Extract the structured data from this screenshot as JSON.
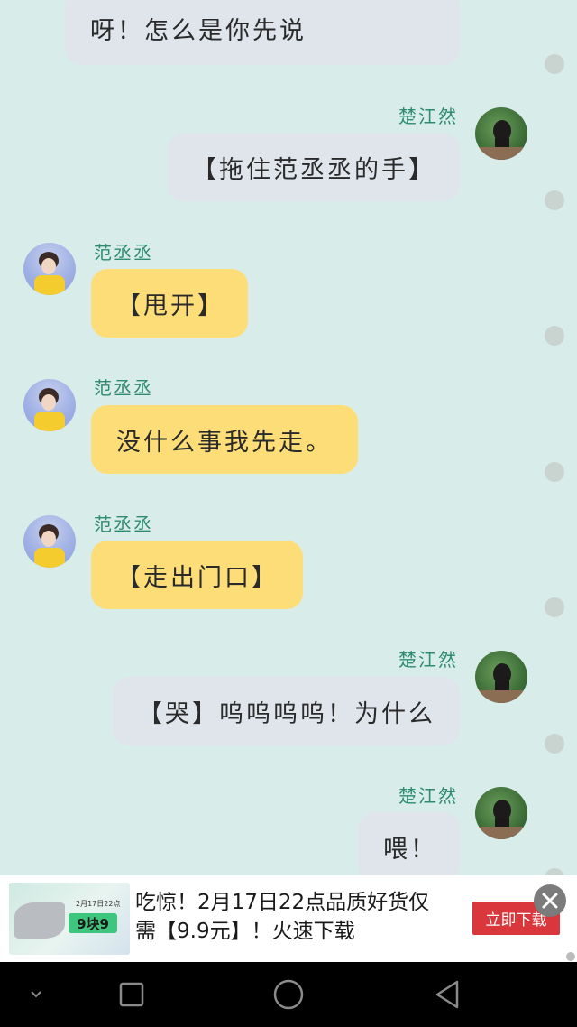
{
  "messages": [
    {
      "side": "right",
      "text": "呀！怎么是你先说"
    },
    {
      "side": "right",
      "sender": "楚江然",
      "text": "【拖住范丞丞的手】"
    },
    {
      "side": "left",
      "sender": "范丞丞",
      "text": "【甩开】"
    },
    {
      "side": "left",
      "sender": "范丞丞",
      "text": "没什么事我先走。"
    },
    {
      "side": "left",
      "sender": "范丞丞",
      "text": "【走出门口】"
    },
    {
      "side": "right",
      "sender": "楚江然",
      "text": "【哭】呜呜呜呜！为什么"
    },
    {
      "side": "right",
      "sender": "楚江然",
      "text": "喂！"
    }
  ],
  "ad": {
    "text": "吃惊！2月17日22点品质好货仅需【9.9元】！火速下载",
    "button_label": "立即下载",
    "thumb_date": "2月17日22点",
    "thumb_tag": "9块9"
  },
  "navbar": {
    "icons": [
      "chevron-down-icon",
      "recent-apps-icon",
      "home-icon",
      "back-icon"
    ]
  },
  "colors": {
    "background": "#d8ede9",
    "bubble_right": "#dfe5ea",
    "bubble_left": "#fddd78",
    "sender_name": "#2e8b6e",
    "ad_button": "#d9373b"
  }
}
